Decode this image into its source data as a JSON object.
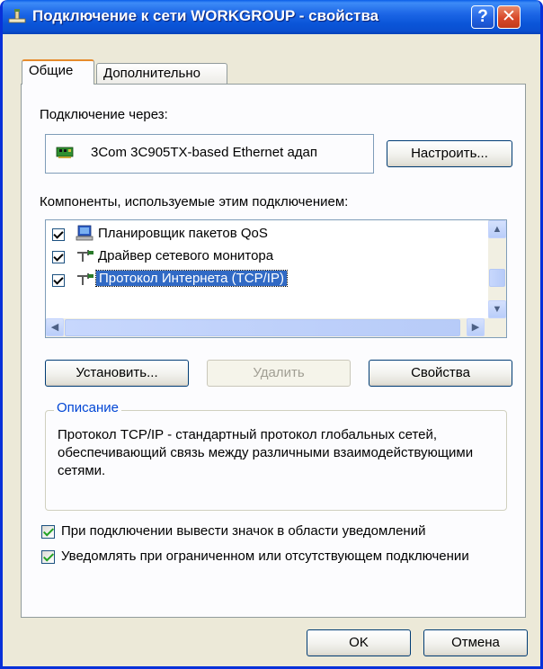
{
  "window": {
    "title": "Подключение к сети WORKGROUP - свойства",
    "help_glyph": "?",
    "close_glyph": "✕"
  },
  "tabs": [
    {
      "label": "Общие",
      "active": true
    },
    {
      "label": "Дополнительно",
      "active": false
    }
  ],
  "connection": {
    "label": "Подключение через:",
    "adapter": "3Com 3C905TX-based Ethernet адап",
    "configure_button": "Настроить..."
  },
  "components": {
    "label": "Компоненты, используемые этим подключением:",
    "items": [
      {
        "label": "Планировщик пакетов QoS",
        "checked": true,
        "icon": "qos-scheduler-icon"
      },
      {
        "label": "Драйвер сетевого монитора",
        "checked": true,
        "icon": "network-protocol-icon"
      },
      {
        "label": "Протокол Интернета (TCP/IP)",
        "checked": true,
        "selected": true,
        "icon": "network-protocol-icon"
      }
    ]
  },
  "actions": {
    "install": "Установить...",
    "remove": "Удалить",
    "properties": "Свойства"
  },
  "description": {
    "legend": "Описание",
    "text": "Протокол TCP/IP - стандартный протокол глобальных сетей, обеспечивающий связь между различными взаимодействующими сетями."
  },
  "options": [
    {
      "label": "При подключении вывести значок в области уведомлений",
      "checked": true
    },
    {
      "label": "Уведомлять при ограниченном или отсутствующем подключении",
      "checked": true
    }
  ],
  "footer": {
    "ok": "OK",
    "cancel": "Отмена"
  },
  "colors": {
    "titlebar": "#0a55d8",
    "selection": "#316ac5",
    "groupbox_legend": "#0046d5",
    "check_green": "#21a121"
  }
}
